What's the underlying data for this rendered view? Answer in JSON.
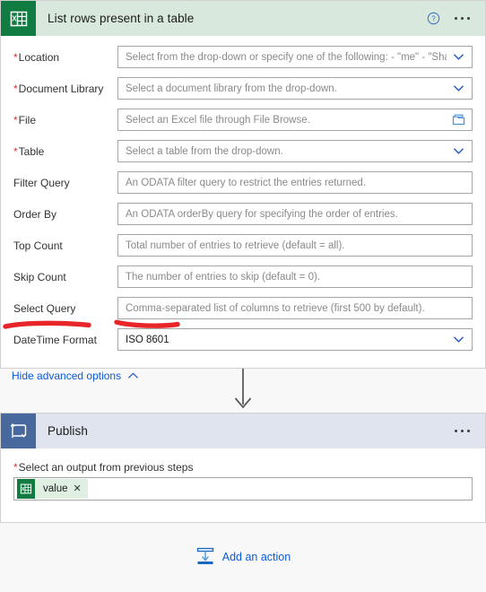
{
  "excel_card": {
    "icon": "excel-icon",
    "title": "List rows present in a table",
    "help_icon": "help-circle-icon",
    "menu_icon": "ellipsis-icon",
    "fields": [
      {
        "label": "Location",
        "required": true,
        "placeholder": "Select from the drop-down or specify one of the following: - \"me\" - \"Shar",
        "value": "",
        "affix": "chevron-down-icon"
      },
      {
        "label": "Document Library",
        "required": true,
        "placeholder": "Select a document library from the drop-down.",
        "value": "",
        "affix": "chevron-down-icon"
      },
      {
        "label": "File",
        "required": true,
        "placeholder": "Select an Excel file through File Browse.",
        "value": "",
        "affix": "folder-browse-icon"
      },
      {
        "label": "Table",
        "required": true,
        "placeholder": "Select a table from the drop-down.",
        "value": "",
        "affix": "chevron-down-icon"
      },
      {
        "label": "Filter Query",
        "required": false,
        "placeholder": "An ODATA filter query to restrict the entries returned.",
        "value": "",
        "affix": ""
      },
      {
        "label": "Order By",
        "required": false,
        "placeholder": "An ODATA orderBy query for specifying the order of entries.",
        "value": "",
        "affix": ""
      },
      {
        "label": "Top Count",
        "required": false,
        "placeholder": "Total number of entries to retrieve (default = all).",
        "value": "",
        "affix": ""
      },
      {
        "label": "Skip Count",
        "required": false,
        "placeholder": "The number of entries to skip (default = 0).",
        "value": "",
        "affix": ""
      },
      {
        "label": "Select Query",
        "required": false,
        "placeholder": "Comma-separated list of columns to retrieve (first 500 by default).",
        "value": "",
        "affix": ""
      },
      {
        "label": "DateTime Format",
        "required": false,
        "placeholder": "",
        "value": "ISO 8601",
        "affix": "chevron-down-icon"
      }
    ],
    "advanced_link": {
      "label": "Hide advanced options",
      "icon": "chevron-up-icon"
    }
  },
  "connector": {
    "icon": "down-arrow-icon"
  },
  "publish_card": {
    "icon": "publish-loop-icon",
    "title": "Publish",
    "menu_icon": "ellipsis-icon",
    "output_field": {
      "label": "Select an output from previous steps",
      "required": true,
      "token": {
        "icon": "excel-icon",
        "label": "value",
        "remove_icon": "close-icon"
      }
    }
  },
  "add_action": {
    "icon": "add-action-icon",
    "label": "Add an action"
  },
  "annotations": [
    {
      "name": "red-underline-datetime-format-label"
    },
    {
      "name": "red-underline-iso-8601-value"
    }
  ],
  "colors": {
    "excel_green": "#107c41",
    "excel_header_bg": "#d8e8dd",
    "publish_blue": "#47699e",
    "publish_header_bg": "#dfe4ee",
    "link_blue": "#0b5cd5",
    "required_red": "#d13438",
    "annotation_red": "#e8262a",
    "page_bg": "#f8f8f8"
  }
}
